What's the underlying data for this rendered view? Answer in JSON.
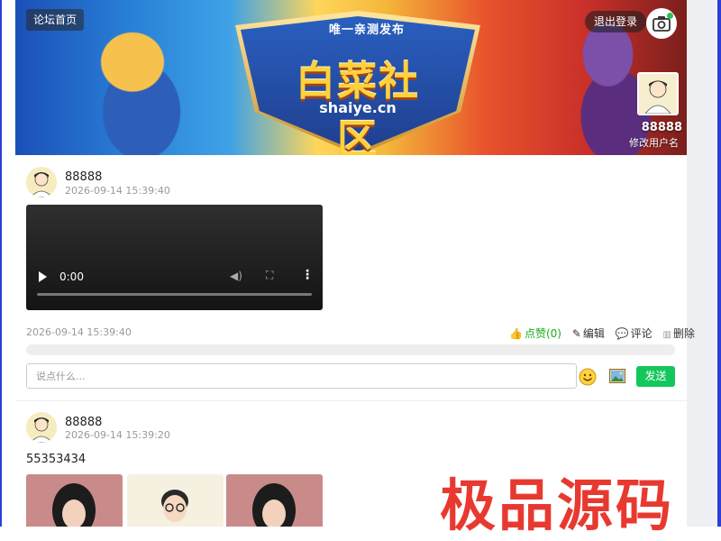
{
  "banner": {
    "home_label": "论坛首页",
    "logout_label": "退出登录",
    "tagline": "唯一亲测发布",
    "brand": "白菜社区",
    "domain": "shaiye.cn",
    "profile": {
      "name": "88888",
      "sub": "修改用户名"
    }
  },
  "posts": [
    {
      "author": "88888",
      "time": "2026-09-14 15:39:40",
      "video": {
        "time": "0:00"
      },
      "meta_time": "2026-09-14 15:39:40",
      "actions": {
        "like": "点赞(0)",
        "edit": "编辑",
        "comment": "评论",
        "delete": "删除"
      },
      "comment_placeholder": "说点什么...",
      "send_label": "发送"
    },
    {
      "author": "88888",
      "time": "2026-09-14 15:39:20",
      "text": "55353434"
    }
  ],
  "watermark": "极品源码",
  "colors": {
    "accent": "#14c75c",
    "like": "#1aad19",
    "frame": "#2b3fd6"
  }
}
